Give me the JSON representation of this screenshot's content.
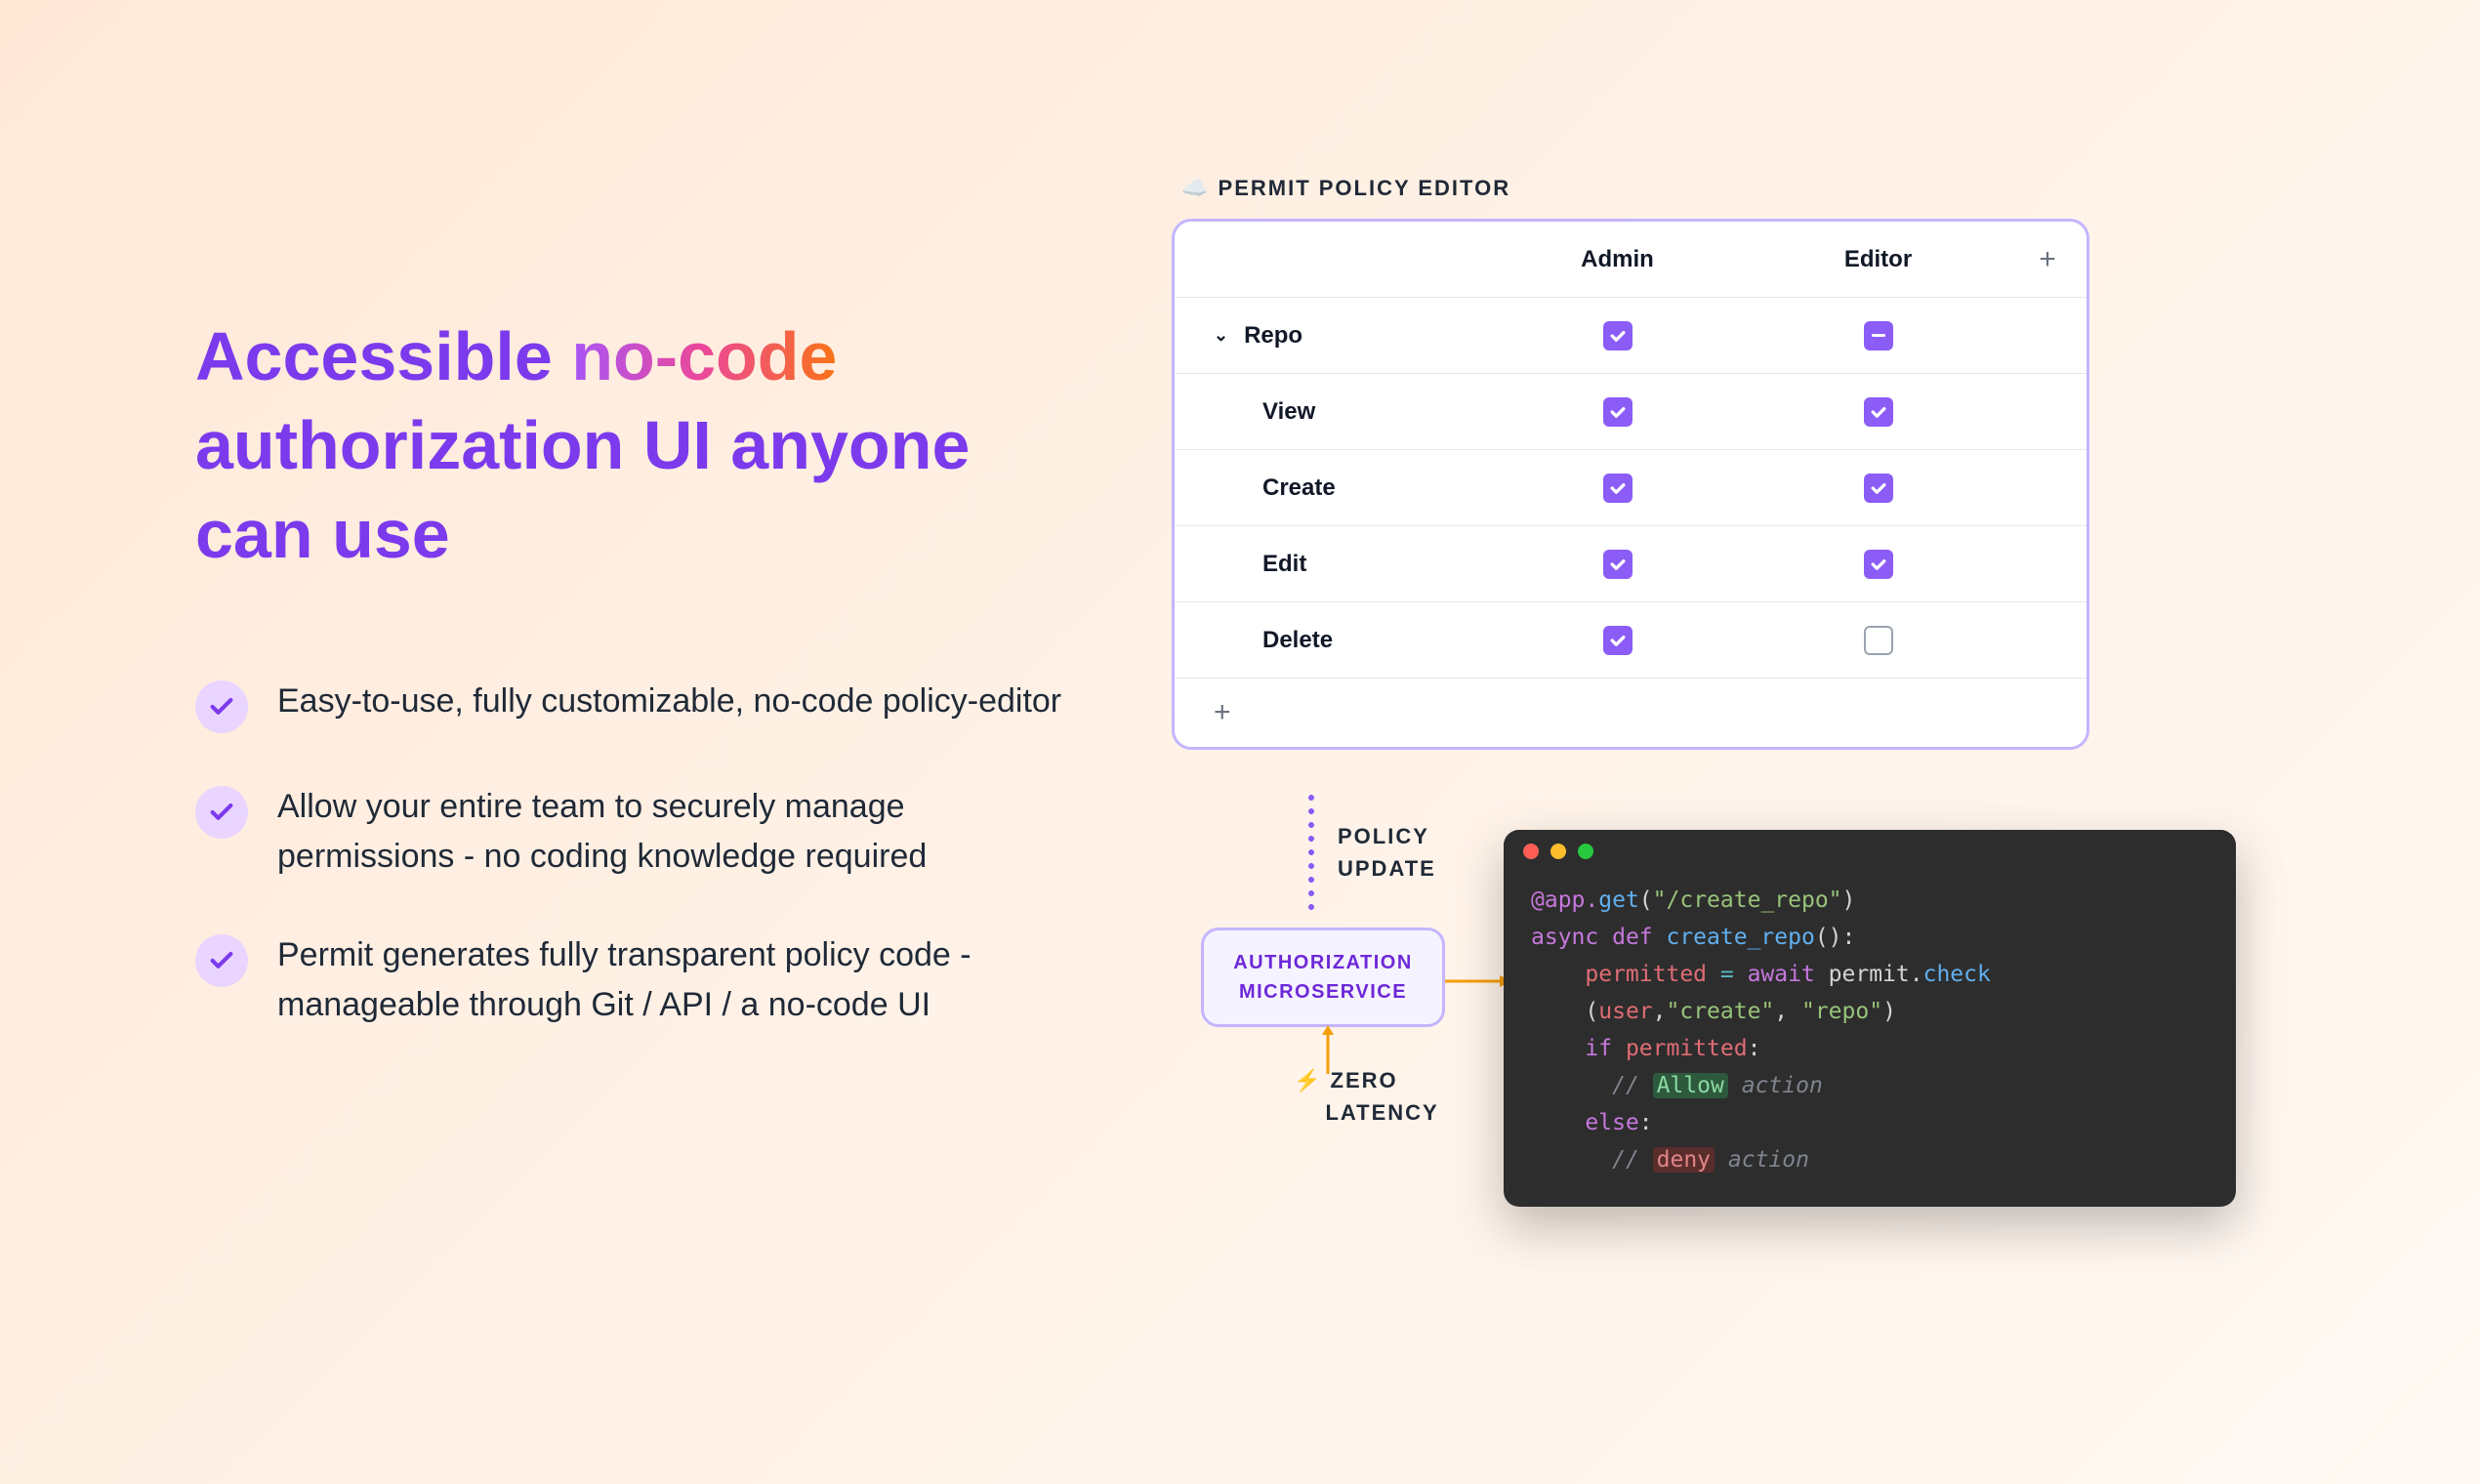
{
  "headline": {
    "part1": "Accessible ",
    "highlight": "no-code",
    "part2": " authorization UI anyone can use"
  },
  "bullets": [
    "Easy-to-use, fully customizable, no-code policy-editor",
    "Allow your entire team to securely manage permissions - no coding knowledge required",
    "Permit generates fully transparent policy code - manageable through Git / API / a no-code UI"
  ],
  "editor": {
    "title_icon": "☁️",
    "title": "PERMIT POLICY EDITOR",
    "columns": [
      "Admin",
      "Editor"
    ],
    "rows": [
      {
        "label": "Repo",
        "expandable": true,
        "values": [
          "checked",
          "indeterminate"
        ]
      },
      {
        "label": "View",
        "child": true,
        "values": [
          "checked",
          "checked"
        ]
      },
      {
        "label": "Create",
        "child": true,
        "values": [
          "checked",
          "checked"
        ]
      },
      {
        "label": "Edit",
        "child": true,
        "values": [
          "checked",
          "checked"
        ]
      },
      {
        "label": "Delete",
        "child": true,
        "values": [
          "checked",
          "empty"
        ]
      }
    ]
  },
  "flow": {
    "policy_update_l1": "POLICY",
    "policy_update_l2": "UPDATE",
    "microservice_l1": "AUTHORIZATION",
    "microservice_l2": "MICROSERVICE",
    "zero_icon": "⚡",
    "zero_l1": "ZERO",
    "zero_l2": "LATENCY"
  },
  "code": {
    "decorator_prefix": "@app.",
    "decorator_fn": "get",
    "route": "\"/create_repo\"",
    "async": "async ",
    "def": "def ",
    "fn_name": "create_repo",
    "assign_var": "permitted ",
    "eq": "= ",
    "await_kw": "await ",
    "permit_obj": "permit.",
    "check_fn": "check",
    "arg_user": "user",
    "arg_create": "\"create\"",
    "arg_repo": "\"repo\"",
    "if_kw": "if ",
    "cond": "permitted",
    "allow_cmt_pre": "// ",
    "allow_word": "Allow",
    "allow_cmt_post": " action",
    "else_kw": "else",
    "deny_cmt_pre": "// ",
    "deny_word": "deny",
    "deny_cmt_post": " action"
  }
}
